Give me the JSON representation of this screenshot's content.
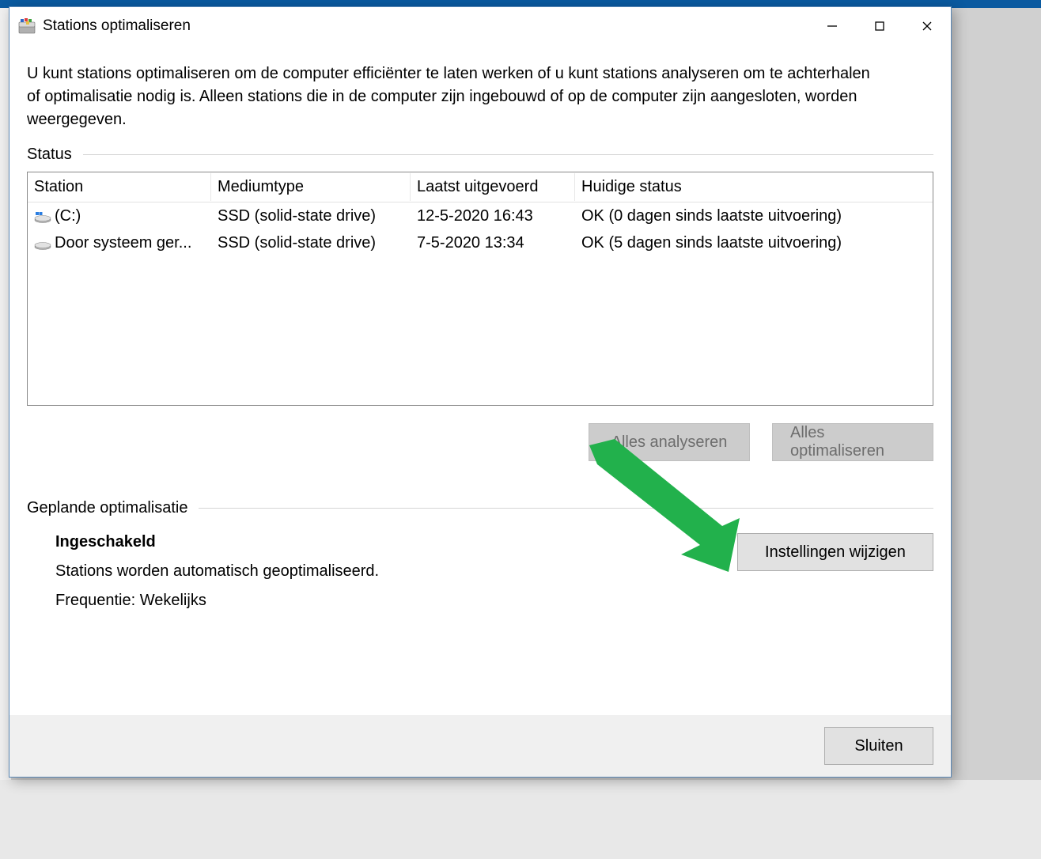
{
  "window": {
    "title": "Stations optimaliseren"
  },
  "intro_text": "U kunt stations optimaliseren om de computer efficiënter te laten werken of u kunt stations analyseren om te achterhalen of optimalisatie nodig is. Alleen stations die in de computer zijn ingebouwd of op de computer zijn aangesloten, worden weergegeven.",
  "status_section_label": "Status",
  "table": {
    "headers": {
      "station": "Station",
      "mediatype": "Mediumtype",
      "last_run": "Laatst uitgevoerd",
      "current_status": "Huidige status"
    },
    "rows": [
      {
        "name": "(C:)",
        "media": "SSD (solid-state drive)",
        "last": "12-5-2020 16:43",
        "status": "OK (0 dagen sinds laatste uitvoering)"
      },
      {
        "name": "Door systeem ger...",
        "media": "SSD (solid-state drive)",
        "last": "7-5-2020 13:34",
        "status": "OK (5 dagen sinds laatste uitvoering)"
      }
    ]
  },
  "buttons": {
    "analyze_all": "Alles analyseren",
    "optimize_all": "Alles optimaliseren",
    "change_settings": "Instellingen wijzigen",
    "close": "Sluiten"
  },
  "schedule_section_label": "Geplande optimalisatie",
  "schedule": {
    "enabled_label": "Ingeschakeld",
    "auto_text": "Stations worden automatisch geoptimaliseerd.",
    "frequency_text": "Frequentie: Wekelijks"
  }
}
